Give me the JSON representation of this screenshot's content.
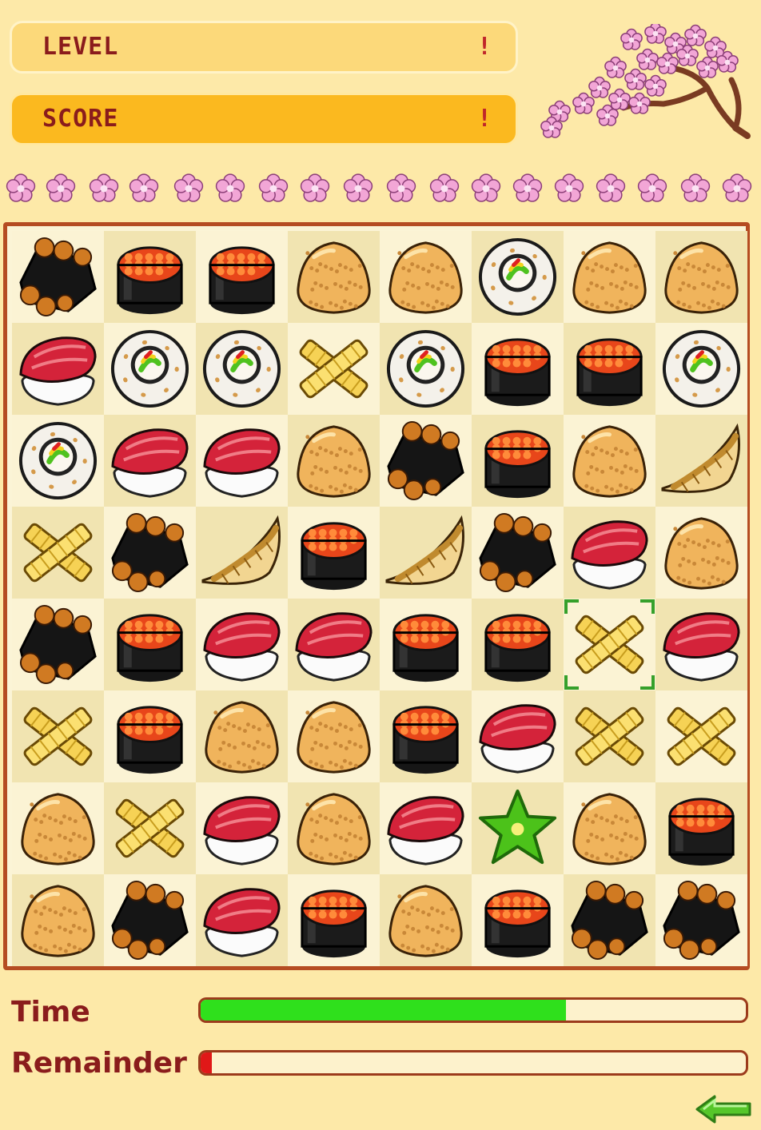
{
  "hud": {
    "level_label": "LEVEL",
    "level_value": "!",
    "score_label": "SCORE",
    "score_value": "!"
  },
  "decorations": {
    "tree_icon": "cherry-blossom-branch-icon",
    "flower_icon": "sakura-flower-icon",
    "flower_count": 18
  },
  "board": {
    "rows": 8,
    "cols": 8,
    "selected": [
      4,
      6
    ],
    "pieces": [
      [
        "uni",
        "ikura",
        "ikura",
        "onigiri",
        "onigiri",
        "roll",
        "onigiri",
        "onigiri"
      ],
      [
        "maguro",
        "roll",
        "roll",
        "tamago",
        "roll",
        "ikura",
        "ikura",
        "roll"
      ],
      [
        "roll",
        "maguro",
        "maguro",
        "onigiri",
        "uni",
        "ikura",
        "onigiri",
        "gyoza"
      ],
      [
        "tamago",
        "uni",
        "gyoza",
        "ikura",
        "gyoza",
        "uni",
        "maguro",
        "onigiri"
      ],
      [
        "uni",
        "ikura",
        "maguro",
        "maguro",
        "ikura",
        "ikura",
        "tamago",
        "maguro"
      ],
      [
        "tamago",
        "ikura",
        "onigiri",
        "onigiri",
        "ikura",
        "maguro",
        "tamago",
        "tamago"
      ],
      [
        "onigiri",
        "tamago",
        "maguro",
        "onigiri",
        "maguro",
        "star",
        "onigiri",
        "ikura"
      ],
      [
        "onigiri",
        "uni",
        "maguro",
        "ikura",
        "onigiri",
        "ikura",
        "uni",
        "uni"
      ]
    ]
  },
  "stats": {
    "time_label": "Time",
    "time_progress": 0.67,
    "remainder_label": "Remainder",
    "remainder_progress": 0.02
  },
  "controls": {
    "back_icon": "green-back-arrow-icon"
  },
  "colors": {
    "background": "#fde9a8",
    "label_text": "#8a1c1c",
    "board_border": "#b54c22",
    "time_bar": "#2fe01c",
    "remainder_bar": "#e01818"
  }
}
